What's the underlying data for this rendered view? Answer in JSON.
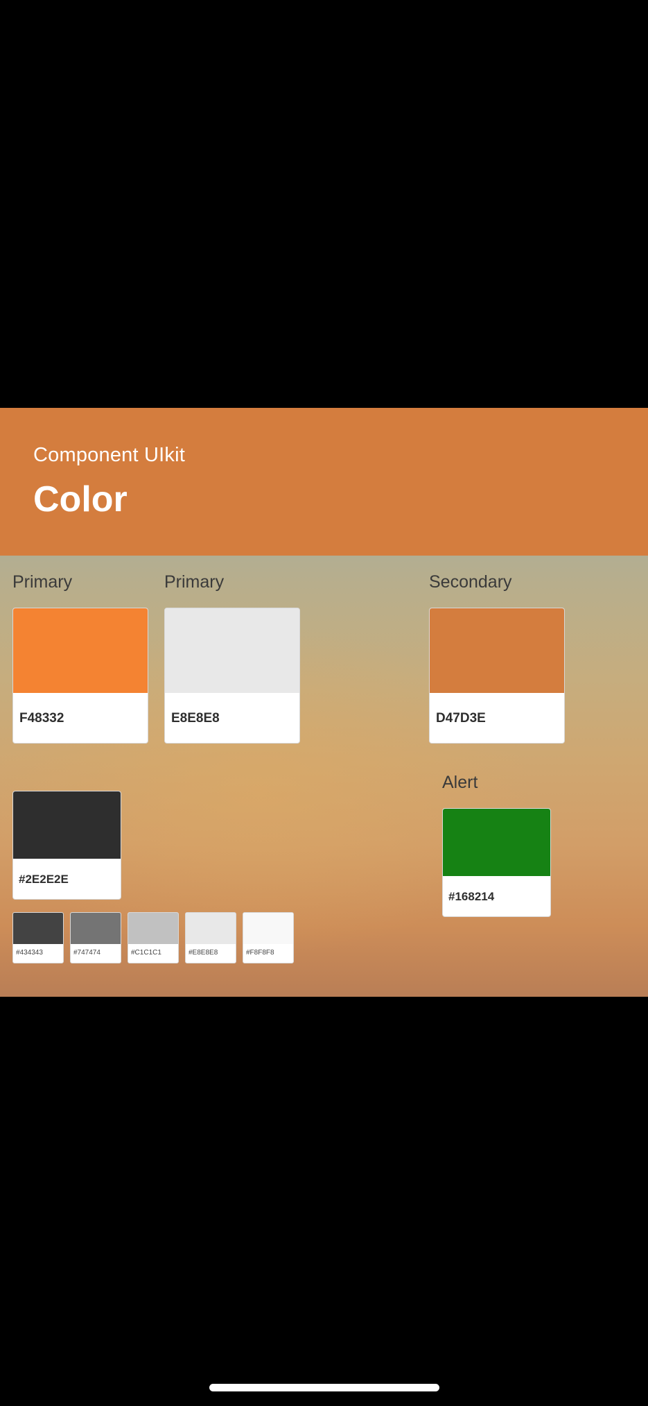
{
  "header": {
    "kicker": "Component UIkit",
    "title": "Color"
  },
  "groups": {
    "primary_1": {
      "label": "Primary",
      "swatch": {
        "hex": "#F48332",
        "code": "F48332"
      }
    },
    "primary_2": {
      "label": "Primary",
      "swatch": {
        "hex": "#E8E8E8",
        "code": "E8E8E8"
      }
    },
    "secondary": {
      "label": "Secondary",
      "swatch": {
        "hex": "#D47D3E",
        "code": "D47D3E"
      }
    },
    "alert": {
      "label": "Alert",
      "swatch": {
        "hex": "#168214",
        "code": "#168214"
      }
    },
    "dark": {
      "swatch": {
        "hex": "#2E2E2E",
        "code": "#2E2E2E"
      }
    },
    "greys": [
      {
        "hex": "#434343",
        "code": "#434343"
      },
      {
        "hex": "#747474",
        "code": "#747474"
      },
      {
        "hex": "#C1C1C1",
        "code": "#C1C1C1"
      },
      {
        "hex": "#E8E8E8",
        "code": "#E8E8E8"
      },
      {
        "hex": "#F8F8F8",
        "code": "#F8F8F8"
      }
    ]
  },
  "colors": {
    "banner": "#D47D3E",
    "background_top": "#97AAA7",
    "background_bottom": "#B97E56"
  }
}
